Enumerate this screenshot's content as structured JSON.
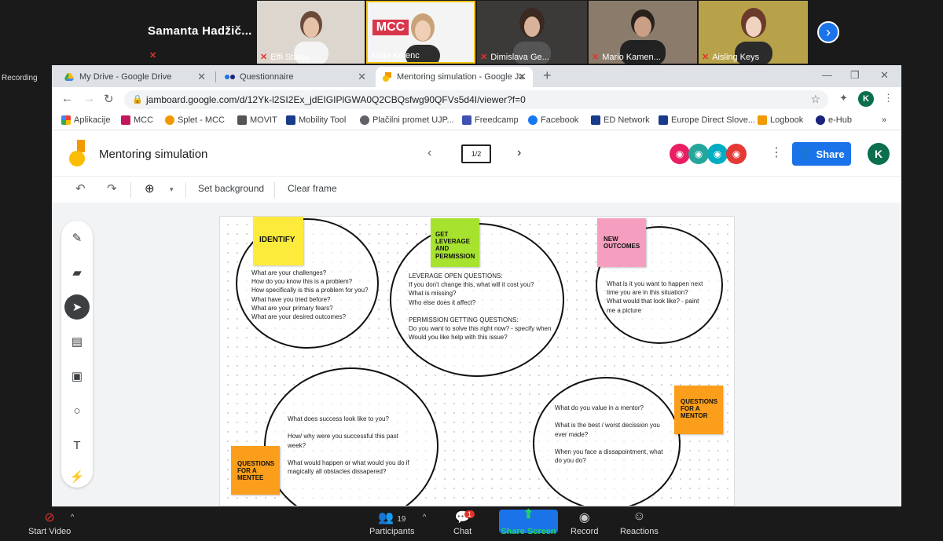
{
  "zoom": {
    "speaker_name": "Samanta  Hadžič...",
    "participants": [
      {
        "name": "Effi Staiou"
      },
      {
        "name": "Katja Kolenc"
      },
      {
        "name": "Dimislava Ge..."
      },
      {
        "name": "Mario Kamen..."
      },
      {
        "name": "Aisling Keys"
      }
    ],
    "recording_label": "Recording",
    "toolbar": {
      "start_video": "Start Video",
      "participants": "Participants",
      "participants_count": "19",
      "chat": "Chat",
      "chat_badge": "1",
      "share_screen": "Share Screen",
      "record": "Record",
      "reactions": "Reactions"
    }
  },
  "browser": {
    "tabs": [
      {
        "title": "My Drive - Google Drive"
      },
      {
        "title": "Questionnaire"
      },
      {
        "title": "Mentoring simulation - Google Ja"
      }
    ],
    "url": "jamboard.google.com/d/12Yk-l2SI2Ex_jdEIGIPlGWA0Q2CBQsfwg90QFVs5d4I/viewer?f=0",
    "profile_initial": "K",
    "bookmarks": [
      {
        "label": "Aplikacije",
        "color": "#ea4335"
      },
      {
        "label": "MCC",
        "color": "#c2185b"
      },
      {
        "label": "Splet - MCC",
        "color": "#f29900"
      },
      {
        "label": "MOVIT",
        "color": "#555555"
      },
      {
        "label": "Mobility Tool",
        "color": "#1a3b8b"
      },
      {
        "label": "Plačilni promet UJP...",
        "color": "#5f6368"
      },
      {
        "label": "Freedcamp",
        "color": "#3f51b5"
      },
      {
        "label": "Facebook",
        "color": "#1877f2"
      },
      {
        "label": "ED Network",
        "color": "#1a3b8b"
      },
      {
        "label": "Europe Direct Slove...",
        "color": "#1a3b8b"
      },
      {
        "label": "Logbook",
        "color": "#f29900"
      },
      {
        "label": "e-Hub",
        "color": "#1a237e"
      }
    ],
    "bookmarks_more": "»"
  },
  "jamboard": {
    "title": "Mentoring simulation",
    "frame_indicator": "1/2",
    "share_label": "Share",
    "profile_initial": "K",
    "toolbar": {
      "set_background": "Set background",
      "clear_frame": "Clear frame"
    },
    "notes": {
      "identify": "IDENTIFY",
      "leverage": "GET LEVERAGE AND PERMISSION",
      "outcomes": "NEW OUTCOMES",
      "mentor": "QUESTIONS FOR A MENTOR",
      "mentee": "QUESTIONS FOR A MENTEE"
    },
    "texts": {
      "identify": "What are your challenges?\nHow do you know this is a problem?\nHow specifically is this a problem for you?\nWhat have you tried before?\nWhat are your primary fears?\nWhat are your desired outcomes?",
      "leverage": "LEVERAGE OPEN QUESTIONS:\nIf you don't change this, what will it cost you?\nWhat is missing?\nWho else does it affect?\n\nPERMISSION GETTING QUESTIONS:\nDo you want to solve this right now? - specify when\nWould you like help with this issue?",
      "outcomes": "What is it you want to happen next time you are in this situation?\nWhat would that look like? - paint me a picture",
      "mentee": "What does success look like to you?\n\nHow/ why were you successful this past week?\n\nWhat would happen or what would you do if magically all obstacles dissapered?",
      "mentor": "What do you value in a mentor?\n\nWhat is the best / worst decission you ever made?\n\nWhen you face a dissapointment, what do you do?"
    }
  }
}
